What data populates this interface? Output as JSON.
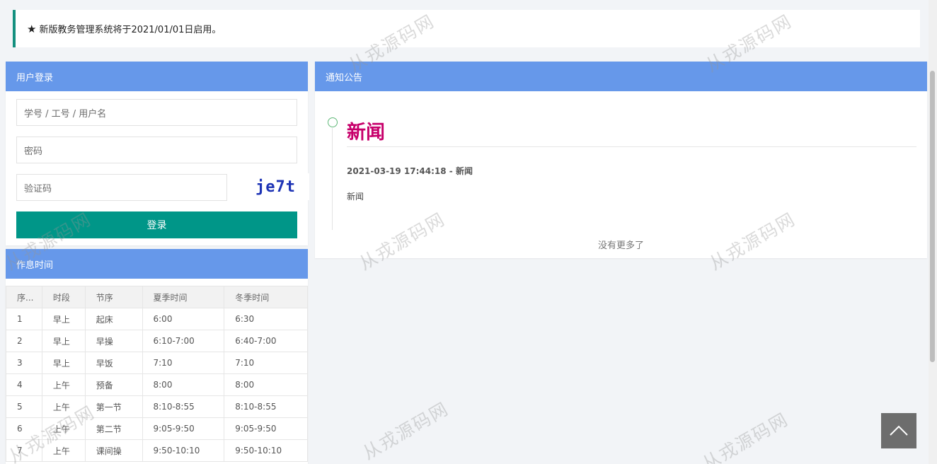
{
  "notice_bar": {
    "star": "★",
    "text": "新版教务管理系统将于2021/01/01日启用。"
  },
  "login": {
    "title": "用户登录",
    "username_placeholder": "学号 / 工号 / 用户名",
    "password_placeholder": "密码",
    "captcha_placeholder": "验证码",
    "captcha_text": "je7t",
    "button_label": "登录"
  },
  "schedule": {
    "title": "作息时间",
    "headers": [
      "序...",
      "时段",
      "节序",
      "夏季时间",
      "冬季时间"
    ],
    "rows": [
      [
        "1",
        "早上",
        "起床",
        "6:00",
        "6:30"
      ],
      [
        "2",
        "早上",
        "早操",
        "6:10-7:00",
        "6:40-7:00"
      ],
      [
        "3",
        "早上",
        "早饭",
        "7:10",
        "7:10"
      ],
      [
        "4",
        "上午",
        "预备",
        "8:00",
        "8:00"
      ],
      [
        "5",
        "上午",
        "第一节",
        "8:10-8:55",
        "8:10-8:55"
      ],
      [
        "6",
        "上午",
        "第二节",
        "9:05-9:50",
        "9:05-9:50"
      ],
      [
        "7",
        "上午",
        "课间操",
        "9:50-10:10",
        "9:50-10:10"
      ]
    ]
  },
  "announcements": {
    "title": "通知公告",
    "item": {
      "heading": "新闻",
      "meta": "2021-03-19 17:44:18 - 新闻",
      "body": "新闻"
    },
    "no_more": "没有更多了"
  },
  "watermark_text": "从戎源码网",
  "colors": {
    "header_blue": "#6698ea",
    "button_teal": "#009688",
    "accent_bar": "#14907f",
    "news_title": "#c7006b",
    "captcha": "#1d33b5"
  },
  "icons": {
    "back_to_top": "chevron-up-icon",
    "timeline": "timeline-dot-icon"
  }
}
